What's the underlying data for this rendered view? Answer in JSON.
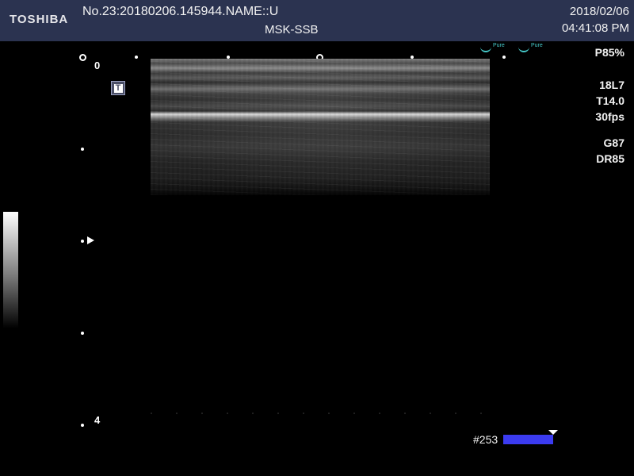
{
  "header": {
    "brand": "TOSHIBA",
    "patient_id": "No.23:20180206.145944.NAME::U",
    "preset": "MSK-SSB",
    "date": "2018/02/06",
    "time": "04:41:08 PM"
  },
  "logos": {
    "pure_left": "Pure",
    "pure_right": "Pure"
  },
  "params": {
    "power": "P85%",
    "probe": "18L7",
    "thi": "T14.0",
    "fps": "30fps",
    "gain": "G87",
    "dynamic_range": "DR85"
  },
  "depth": {
    "top": "0",
    "bottom": "4"
  },
  "frame": {
    "counter": "#253"
  },
  "colors": {
    "header_bg": "#2b3350",
    "frame_bar": "#3b3bf0",
    "logo_accent": "#46c9c9"
  }
}
